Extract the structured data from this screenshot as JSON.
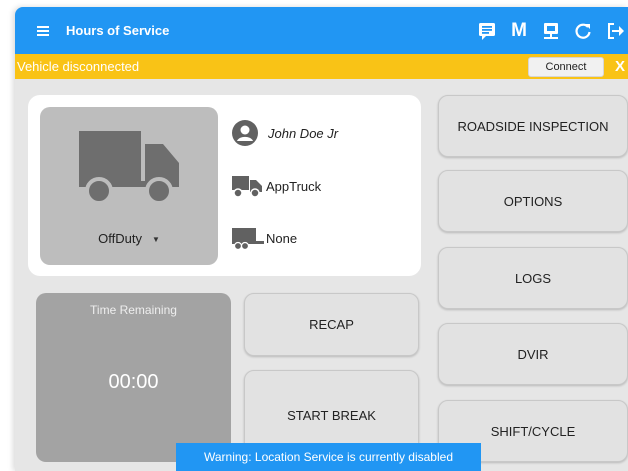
{
  "app_bar": {
    "title": "Hours of Service",
    "icons": [
      "menu-icon",
      "message-icon",
      "m-icon",
      "server-icon",
      "refresh-icon",
      "logout-icon"
    ],
    "m_label": "M"
  },
  "connection_bar": {
    "message": "Vehicle disconnected",
    "connect_label": "Connect",
    "dismiss_label": "X"
  },
  "driver_card": {
    "duty_status": "OffDuty",
    "driver_name": "John Doe Jr",
    "vehicle": "AppTruck",
    "trailer": "None"
  },
  "time_remaining": {
    "label": "Time Remaining",
    "value": "00:00"
  },
  "center_buttons": {
    "recap": "RECAP",
    "start_break": "START BREAK"
  },
  "side_buttons": {
    "roadside_inspection": "ROADSIDE INSPECTION",
    "options": "OPTIONS",
    "logs": "LOGS",
    "dvir": "DVIR",
    "shift_cycle": "SHIFT/CYCLE"
  },
  "toast": {
    "message": "Warning: Location Service is currently disabled"
  },
  "colors": {
    "primary": "#2196f3",
    "warning": "#f9c316",
    "tile_gray": "#bdbdbd",
    "time_tile": "#a3a3a3"
  }
}
